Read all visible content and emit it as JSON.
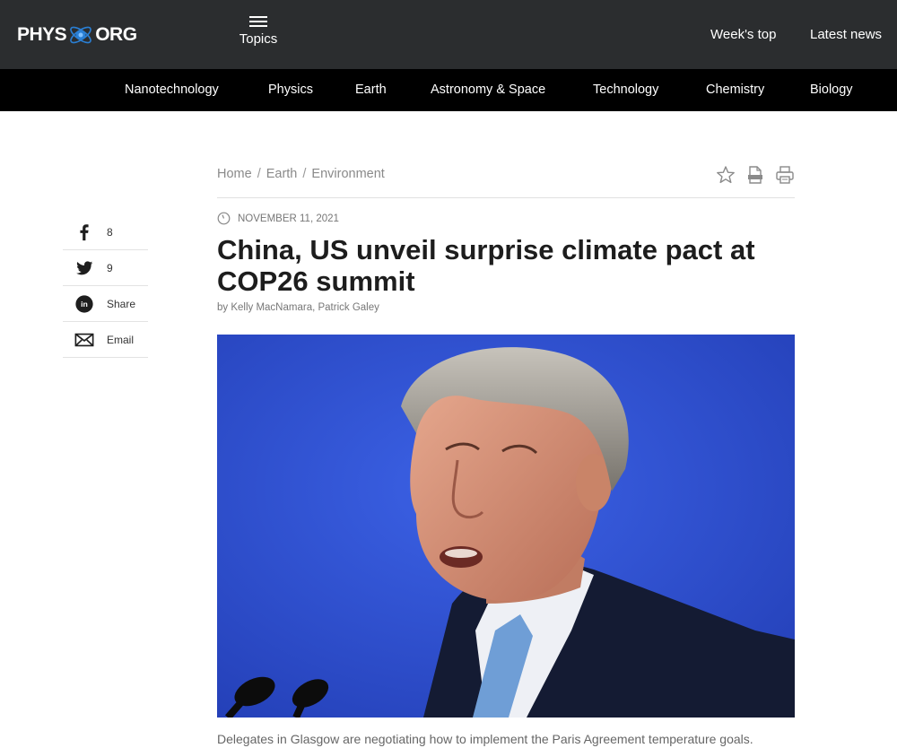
{
  "header": {
    "logo_left": "PHYS",
    "logo_right": "ORG",
    "topics_label": "Topics",
    "links": [
      "Week's top",
      "Latest news"
    ]
  },
  "categories": [
    "Nanotechnology",
    "Physics",
    "Earth",
    "Astronomy & Space",
    "Technology",
    "Chemistry",
    "Biology"
  ],
  "breadcrumb": [
    "Home",
    "Earth",
    "Environment"
  ],
  "breadcrumb_separator": "/",
  "tools_icons": [
    "star-icon",
    "pdf-icon",
    "print-icon"
  ],
  "article": {
    "date": "NOVEMBER 11, 2021",
    "title": "China, US unveil surprise climate pact at COP26 summit",
    "byline": "by Kelly MacNamara, Patrick Galey",
    "caption": "Delegates in Glasgow are negotiating how to implement the Paris Agreement temperature goals."
  },
  "social": [
    {
      "icon": "facebook-icon",
      "label": "8"
    },
    {
      "icon": "twitter-icon",
      "label": "9"
    },
    {
      "icon": "linkedin-icon",
      "label": "Share"
    },
    {
      "icon": "email-icon",
      "label": "Email"
    }
  ],
  "colors": {
    "topbar": "#2b2d2f",
    "catnav": "#000000",
    "logo_accent": "#2a7fd4",
    "image_background": "#2f4fd1"
  }
}
